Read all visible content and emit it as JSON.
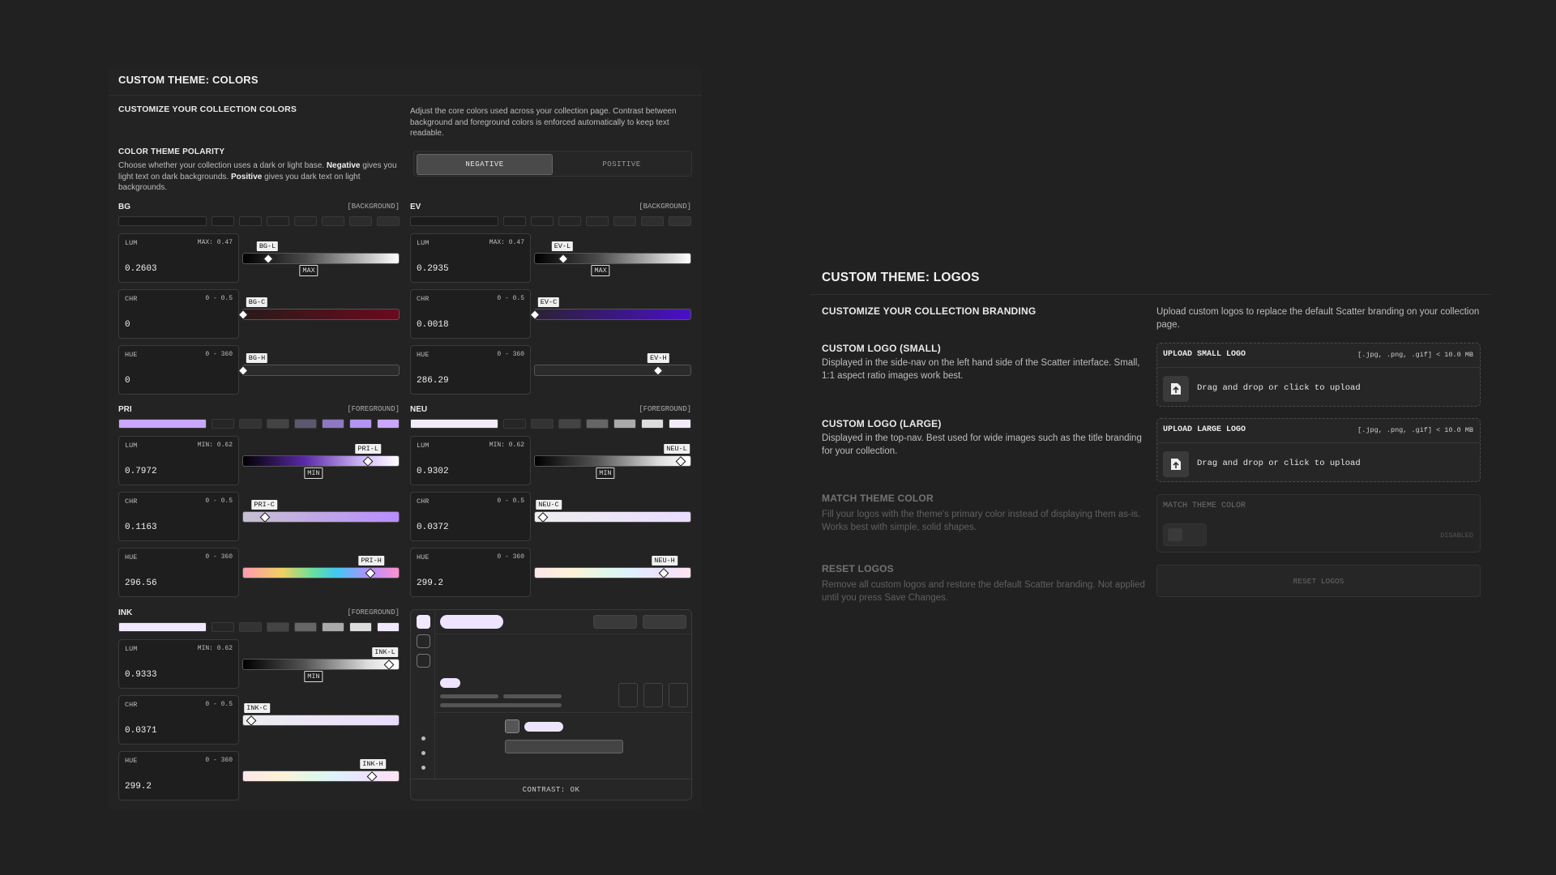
{
  "colors": {
    "title": "CUSTOM THEME: COLORS",
    "section_title": "CUSTOMIZE YOUR COLLECTION COLORS",
    "section_desc": "Adjust the core colors used across your collection page. Contrast between background and foreground colors is enforced automatically to keep text readable.",
    "polarity": {
      "title": "COLOR THEME POLARITY",
      "desc_1": "Choose whether your collection uses a dark or light base. ",
      "desc_neg": "Negative",
      "desc_2": " gives you light text on dark backgrounds. ",
      "desc_pos": "Positive",
      "desc_3": " gives you dark text on light backgrounds.",
      "options": [
        "NEGATIVE",
        "POSITIVE"
      ],
      "selected": "NEGATIVE"
    },
    "groups": [
      {
        "name": "BG",
        "role": "[BACKGROUND]",
        "swatches": [
          "#1a1a1a",
          "#1d1d1d",
          "#202020",
          "#232323",
          "#262626",
          "#292929",
          "#2c2c2c",
          "#2f2f2f"
        ],
        "fields": [
          {
            "label": "LUM",
            "range": "MAX: 0.47",
            "value": "0.2603",
            "tag": "BG-L",
            "pos": 0.16,
            "gradient": "linear-gradient(90deg,#000,#4a4a4a 40%,#fff)",
            "limit": "MAX",
            "limit_pos": 0.32
          },
          {
            "label": "CHR",
            "range": "0 - 0.5",
            "value": "0",
            "tag": "BG-C",
            "pos": 0.0,
            "gradient": "linear-gradient(90deg,#2a1a1a,#6b0a1e)"
          },
          {
            "label": "HUE",
            "range": "0 - 360",
            "value": "0",
            "tag": "BG-H",
            "pos": 0.0,
            "gradient": "linear-gradient(90deg,#2b2b2b,#2b2b2b)"
          }
        ]
      },
      {
        "name": "EV",
        "role": "[BACKGROUND]",
        "swatches": [
          "#1c1c1c",
          "#1f1f1f",
          "#222",
          "#252525",
          "#282828",
          "#2b2b2b",
          "#2e2e2e",
          "#313131"
        ],
        "fields": [
          {
            "label": "LUM",
            "range": "MAX: 0.47",
            "value": "0.2935",
            "tag": "EV-L",
            "pos": 0.18,
            "gradient": "linear-gradient(90deg,#000,#4a4a4a 40%,#fff)",
            "limit": "MAX",
            "limit_pos": 0.32
          },
          {
            "label": "CHR",
            "range": "0 - 0.5",
            "value": "0.0018",
            "tag": "EV-C",
            "pos": 0.0,
            "gradient": "linear-gradient(90deg,#2a2233,#4a0fc8)"
          },
          {
            "label": "HUE",
            "range": "0 - 360",
            "value": "286.29",
            "tag": "EV-H",
            "pos": 0.79,
            "gradient": "linear-gradient(90deg,#2b2b2b,#2b2b2b)"
          }
        ]
      },
      {
        "name": "PRI",
        "role": "[FOREGROUND]",
        "swatches": [
          "#c9a6ff",
          "#262626",
          "#333",
          "#444",
          "#5d5670",
          "#8f78c2",
          "#b494f0",
          "#c9a6ff"
        ],
        "fields": [
          {
            "label": "LUM",
            "range": "MIN: 0.62",
            "value": "0.7972",
            "tag": "PRI-L",
            "pos": 0.8,
            "gradient": "linear-gradient(90deg,#000,#5b2aa8 40%,#d9c4ff 80%,#fff)",
            "limit": "MIN",
            "limit_pos": 0.35
          },
          {
            "label": "CHR",
            "range": "0 - 0.5",
            "value": "0.1163",
            "tag": "PRI-C",
            "pos": 0.14,
            "gradient": "linear-gradient(90deg,#c7c0d0,#b88cff)"
          },
          {
            "label": "HUE",
            "range": "0 - 360",
            "value": "296.56",
            "tag": "PRI-H",
            "pos": 0.82,
            "gradient": "linear-gradient(90deg,#ff9ab0,#f0d060 25%,#66e0a0 45%,#40c8f0 60%,#b090ff 80%,#ff90d0)"
          }
        ]
      },
      {
        "name": "NEU",
        "role": "[FOREGROUND]",
        "swatches": [
          "#f1ecf8",
          "#262626",
          "#333",
          "#444",
          "#666",
          "#aaa",
          "#ddd",
          "#f1ecf8"
        ],
        "fields": [
          {
            "label": "LUM",
            "range": "MIN: 0.62",
            "value": "0.9302",
            "tag": "NEU-L",
            "pos": 0.94,
            "gradient": "linear-gradient(90deg,#000,#555 40%,#ddd 80%,#fff)",
            "limit": "MIN",
            "limit_pos": 0.35
          },
          {
            "label": "CHR",
            "range": "0 - 0.5",
            "value": "0.0372",
            "tag": "NEU-C",
            "pos": 0.05,
            "gradient": "linear-gradient(90deg,#eeeeee,#e9dcff)"
          },
          {
            "label": "HUE",
            "range": "0 - 360",
            "value": "299.2",
            "tag": "NEU-H",
            "pos": 0.83,
            "gradient": "linear-gradient(90deg,#ffe6ea,#fff2d6 25%,#e0f8ea 45%,#def2fb 60%,#ece2ff 80%,#ffe4f2)"
          }
        ]
      },
      {
        "name": "INK",
        "role": "[FOREGROUND]",
        "swatches": [
          "#f0e8ff",
          "#262626",
          "#333",
          "#444",
          "#666",
          "#aaa",
          "#ddd",
          "#f0e8ff"
        ],
        "fields": [
          {
            "label": "LUM",
            "range": "MIN: 0.62",
            "value": "0.9333",
            "tag": "INK-L",
            "pos": 0.94,
            "gradient": "linear-gradient(90deg,#000,#555 40%,#ddd 80%,#fff)",
            "limit": "MIN",
            "limit_pos": 0.35
          },
          {
            "label": "CHR",
            "range": "0 - 0.5",
            "value": "0.0371",
            "tag": "INK-C",
            "pos": 0.05,
            "gradient": "linear-gradient(90deg,#eeeeee,#e9dcff)"
          },
          {
            "label": "HUE",
            "range": "0 - 360",
            "value": "299.2",
            "tag": "INK-H",
            "pos": 0.83,
            "gradient": "linear-gradient(90deg,#ffe6ea,#fff2d6 25%,#e0f8ea 45%,#def2fb 60%,#ece2ff 80%,#ffe4f2)"
          }
        ]
      }
    ],
    "preview": {
      "contrast": "CONTRAST: OK"
    }
  },
  "logos": {
    "title": "CUSTOM THEME: LOGOS",
    "section_title": "CUSTOMIZE YOUR COLLECTION BRANDING",
    "section_desc": "Upload custom logos to replace the default Scatter branding on your collection page.",
    "small": {
      "title": "CUSTOM LOGO (SMALL)",
      "desc": "Displayed in the side-nav on the left hand side of the Scatter interface. Small, 1:1 aspect ratio images work best.",
      "upload_title": "UPLOAD SMALL LOGO",
      "hint": "[.jpg, .png, .gif] < 10.0 MB",
      "drop": "Drag and drop or click to upload"
    },
    "large": {
      "title": "CUSTOM LOGO (LARGE)",
      "desc": "Displayed in the top-nav. Best used for wide images such as the title branding for your collection.",
      "upload_title": "UPLOAD LARGE LOGO",
      "hint": "[.jpg, .png, .gif] < 10.0 MB",
      "drop": "Drag and drop or click to upload"
    },
    "match": {
      "title": "MATCH THEME COLOR",
      "desc": "Fill your logos with the theme's primary color instead of displaying them as-is. Works best with simple, solid shapes.",
      "box_title": "MATCH THEME COLOR",
      "state": "DISABLED"
    },
    "reset": {
      "title": "RESET LOGOS",
      "desc": "Remove all custom logos and restore the default Scatter branding. Not applied until you press Save Changes.",
      "button": "RESET LOGOS"
    }
  }
}
